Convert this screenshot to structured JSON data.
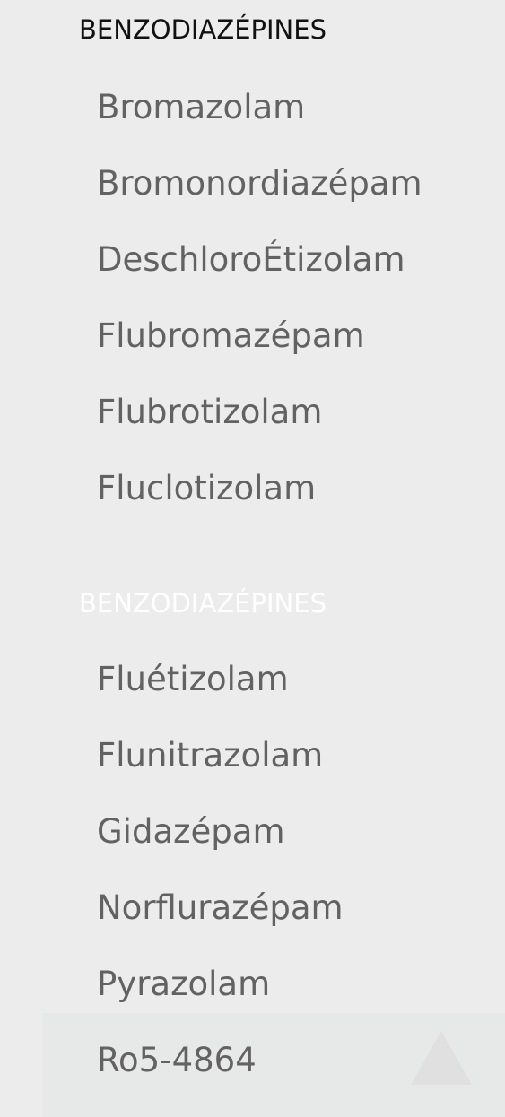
{
  "menu": {
    "sections": [
      {
        "title": "BENZODIAZÉPINES",
        "items": [
          "Bromazolam",
          "Bromonordiazépam",
          "DeschloroÉtizolam",
          "Flubromazépam",
          "Flubrotizolam",
          "Fluclotizolam"
        ]
      },
      {
        "title": "BENZODIAZÉPINES",
        "items": [
          "Fluétizolam",
          "Flunitrazolam",
          "Gidazépam",
          "Norflurazépam",
          "Pyrazolam",
          "Ro5-4864"
        ]
      }
    ]
  },
  "colors": {
    "background": "#ececec",
    "section_title_1": "#111111",
    "section_title_2": "#ffffff",
    "item_text": "#626262"
  }
}
